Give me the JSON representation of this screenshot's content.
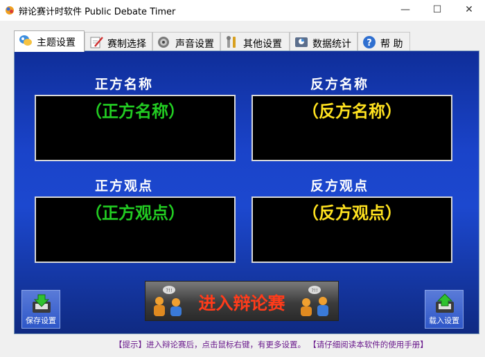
{
  "window": {
    "title": "辩论赛计时软件 Public Debate Timer",
    "minimize": "—",
    "maximize": "☐",
    "close": "✕"
  },
  "tabs": [
    {
      "label": "主题设置",
      "icon": "theme-icon",
      "active": true
    },
    {
      "label": "赛制选择",
      "icon": "pen-paper-icon"
    },
    {
      "label": "声音设置",
      "icon": "speaker-icon"
    },
    {
      "label": "其他设置",
      "icon": "wrench-icon"
    },
    {
      "label": "数据统计",
      "icon": "stats-icon"
    },
    {
      "label": "帮 助",
      "icon": "help-icon"
    }
  ],
  "main": {
    "affirmative_name_label": "正方名称",
    "negative_name_label": "反方名称",
    "affirmative_name_value": "（正方名称）",
    "negative_name_value": "（反方名称）",
    "affirmative_view_label": "正方观点",
    "negative_view_label": "反方观点",
    "affirmative_view_value": "（正方观点）",
    "negative_view_value": "（反方观点）",
    "save_label": "保存设置",
    "load_label": "载入设置",
    "enter_label": "进入辩论赛"
  },
  "status": {
    "tip": "【提示】进入辩论赛后，点击鼠标右键，有更多设置。",
    "manual": "【请仔细阅读本软件的使用手册】"
  },
  "colors": {
    "panel_blue": "#1a43c9",
    "affirmative_text": "#22cc22",
    "negative_text": "#ffe21f",
    "enter_text": "#ff3b1a",
    "status_text": "#6a1a8c"
  }
}
